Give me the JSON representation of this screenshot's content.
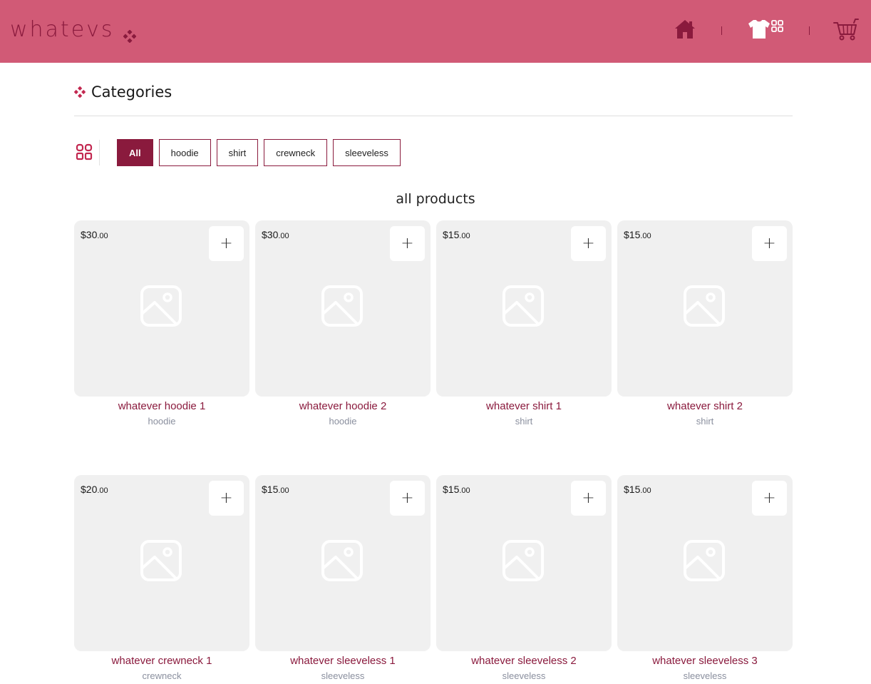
{
  "brand": {
    "name": "whatevs"
  },
  "nav": {
    "home_icon": "home-icon",
    "shop_icon": "tshirt-grid-icon",
    "cart_icon": "cart-icon"
  },
  "categories": {
    "title": "Categories",
    "filters": [
      {
        "label": "All",
        "active": true
      },
      {
        "label": "hoodie",
        "active": false
      },
      {
        "label": "shirt",
        "active": false
      },
      {
        "label": "crewneck",
        "active": false
      },
      {
        "label": "sleeveless",
        "active": false
      }
    ]
  },
  "products_section": {
    "title": "all products",
    "add_symbol": "+"
  },
  "products": [
    {
      "price_main": "$30",
      "price_cents": ".00",
      "name": "whatever hoodie 1",
      "category": "hoodie"
    },
    {
      "price_main": "$30",
      "price_cents": ".00",
      "name": "whatever hoodie 2",
      "category": "hoodie"
    },
    {
      "price_main": "$15",
      "price_cents": ".00",
      "name": "whatever shirt 1",
      "category": "shirt"
    },
    {
      "price_main": "$15",
      "price_cents": ".00",
      "name": "whatever shirt 2",
      "category": "shirt"
    },
    {
      "price_main": "$20",
      "price_cents": ".00",
      "name": "whatever crewneck 1",
      "category": "crewneck"
    },
    {
      "price_main": "$15",
      "price_cents": ".00",
      "name": "whatever sleeveless 1",
      "category": "sleeveless"
    },
    {
      "price_main": "$15",
      "price_cents": ".00",
      "name": "whatever sleeveless 2",
      "category": "sleeveless"
    },
    {
      "price_main": "$15",
      "price_cents": ".00",
      "name": "whatever sleeveless 3",
      "category": "sleeveless"
    }
  ],
  "colors": {
    "header_bg": "#d15a76",
    "accent": "#8a1a3d",
    "tile_bg": "#f0f0f0",
    "category_text": "#8a8f9e"
  }
}
